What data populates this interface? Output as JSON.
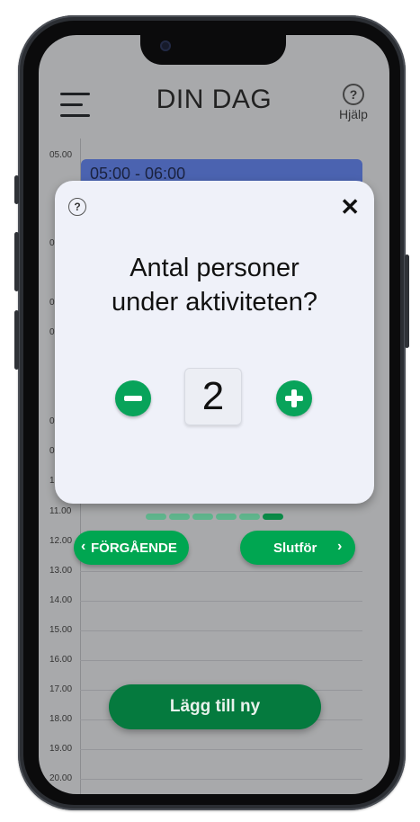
{
  "header": {
    "title": "DIN DAG",
    "help_label": "Hjälp",
    "help_symbol": "?"
  },
  "timeline": {
    "event_time": "05:00 - 06:00",
    "labels_visible": [
      "05.00",
      "11.00",
      "12.00",
      "13.00",
      "14.00",
      "15.00",
      "16.00",
      "17.00",
      "18.00",
      "19.00",
      "20.00"
    ],
    "partial_labels": [
      "0",
      "0",
      "0",
      "0",
      "0",
      "1"
    ]
  },
  "modal": {
    "help_symbol": "?",
    "close_symbol": "✕",
    "question_line1": "Antal personer",
    "question_line2": "under aktiviteten?",
    "value": "2"
  },
  "progress": {
    "steps": 6,
    "current_step": 6
  },
  "nav": {
    "prev_label": "FÖRGÅENDE",
    "next_label": "Slutför",
    "prev_chevron": "‹",
    "next_chevron": "›"
  },
  "add_button": {
    "label": "Lägg till ny"
  },
  "colors": {
    "accent_green": "#00a651",
    "dark_green": "#057a3e",
    "event_blue": "#4b63b0",
    "overlay_gray": "#a8a9ab",
    "modal_bg": "#eff1f9"
  }
}
